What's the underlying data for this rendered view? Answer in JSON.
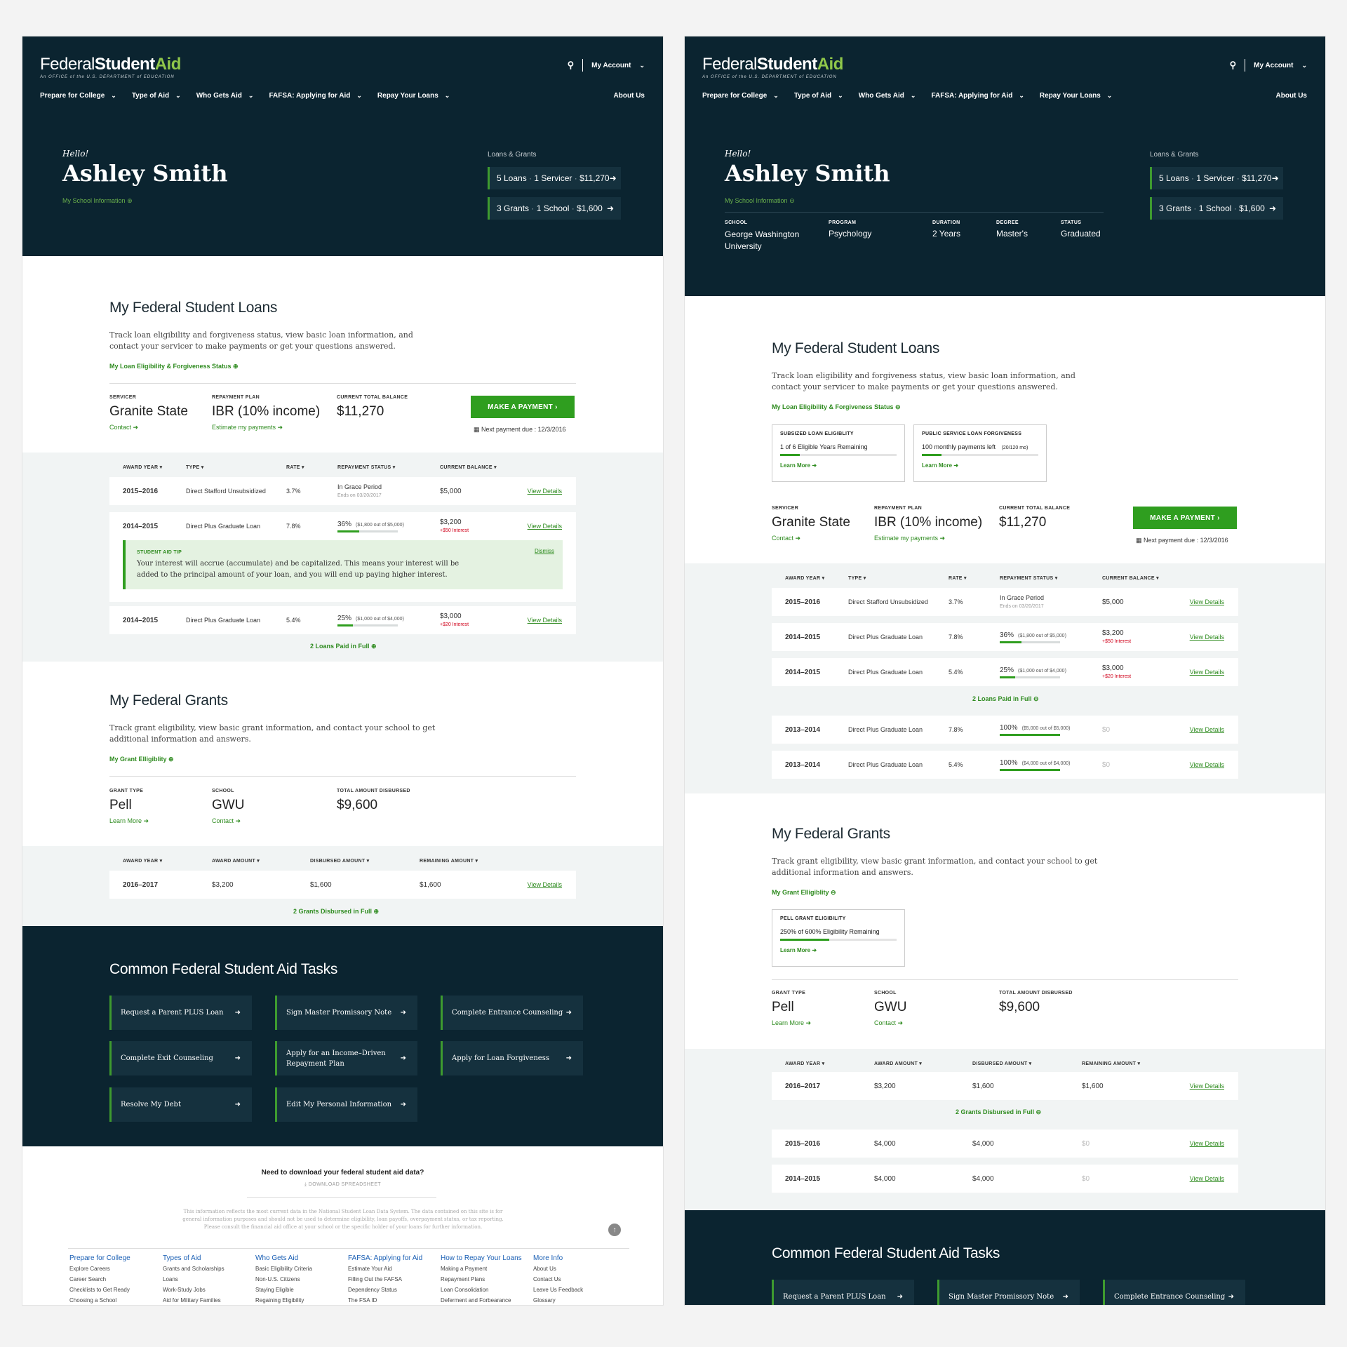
{
  "brand": {
    "federal": "Federal",
    "student": "Student",
    "aid": "Aid",
    "sub": "An OFFICE of the U.S. DEPARTMENT of EDUCATION"
  },
  "account": {
    "label": "My Account"
  },
  "nav": {
    "items": [
      "Prepare for College",
      "Type of Aid",
      "Who Gets Aid",
      "FAFSA: Applying for Aid",
      "Repay Your Loans"
    ],
    "about": "About Us"
  },
  "profile": {
    "hello": "Hello!",
    "name": "Ashley Smith",
    "school_info": "My School Information"
  },
  "summary": {
    "title": "Loans & Grants",
    "loans": {
      "count": "5 Loans",
      "servicer": "1 Servicer",
      "amount": "$11,270"
    },
    "grants": {
      "count": "3 Grants",
      "school": "1 School",
      "amount": "$1,600"
    }
  },
  "school": {
    "cols": [
      {
        "k": "SCHOOL",
        "v": "George Washington University"
      },
      {
        "k": "PROGRAM",
        "v": "Psychology"
      },
      {
        "k": "DURATION",
        "v": "2 Years"
      },
      {
        "k": "DEGREE",
        "v": "Master's"
      },
      {
        "k": "STATUS",
        "v": "Graduated"
      }
    ]
  },
  "loans": {
    "title": "My Federal Student Loans",
    "desc": "Track loan eligibility and forgiveness status, view basic loan information, and contact your servicer to make payments or get your questions answered.",
    "elig_link": "My Loan Eligibility & Forgiveness Status",
    "elig_boxes": [
      {
        "title": "SUBSIZED LOAN ELIGIBLITY",
        "value": "1 of 6 Eligible Years Remaining",
        "extra": "",
        "fill": 0.17,
        "link": "Learn More"
      },
      {
        "title": "PUBLIC SERVICE LOAN FORGIVENESS",
        "value": "100 monthly payments left",
        "extra": "(20/120 mo)",
        "fill": 0.17,
        "link": "Learn More"
      }
    ],
    "servicer_label": "SERVICER",
    "servicer": "Granite State",
    "contact": "Contact",
    "plan_label": "REPAYMENT PLAN",
    "plan": "IBR (10% income)",
    "estimate": "Estimate my payments",
    "balance_label": "CURRENT TOTAL BALANCE",
    "balance": "$11,270",
    "pay_button": "MAKE A PAYMENT",
    "next_payment": "Next payment due : 12/3/2016",
    "headers": [
      "AWARD YEAR",
      "TYPE",
      "RATE",
      "REPAYMENT STATUS",
      "CURRENT BALANCE"
    ],
    "rows": [
      {
        "year": "2015–2016",
        "type": "Direct Stafford Unsubsidized",
        "rate": "3.7%",
        "status": "In Grace Period",
        "status_sub": "Ends on 03/20/2017",
        "balance": "$5,000",
        "interest": "",
        "link": "View Details"
      },
      {
        "year": "2014–2015",
        "type": "Direct Plus Graduate Loan",
        "rate": "7.8%",
        "pct": "36%",
        "pct_detail": "($1,800 out of $5,000)",
        "fill": 0.36,
        "balance": "$3,200",
        "interest": "+$50 Interest",
        "link": "View Details"
      },
      {
        "year": "2014–2015",
        "type": "Direct Plus Graduate Loan",
        "rate": "5.4%",
        "pct": "25%",
        "pct_detail": "($1,000 out of $4,000)",
        "fill": 0.25,
        "balance": "$3,000",
        "interest": "+$20 Interest",
        "link": "View Details"
      }
    ],
    "paid_rows": [
      {
        "year": "2013–2014",
        "type": "Direct Plus Graduate Loan",
        "rate": "7.8%",
        "pct": "100%",
        "pct_detail": "($5,000 out of $5,000)",
        "fill": 1,
        "balance": "$0",
        "link": "View Details"
      },
      {
        "year": "2013–2014",
        "type": "Direct Plus Graduate Loan",
        "rate": "5.4%",
        "pct": "100%",
        "pct_detail": "($4,000 out of $4,000)",
        "fill": 1,
        "balance": "$0",
        "link": "View Details"
      }
    ],
    "tip": {
      "label": "STUDENT AID TIP",
      "dismiss": "Dismiss",
      "text": "Your interest will accrue (accumulate) and be capitalized. This means your interest will be added to the principal amount of your loan, and you will end up paying higher interest."
    },
    "paid_link": "2 Loans Paid in Full"
  },
  "grants": {
    "title": "My Federal Grants",
    "desc": "Track grant eligibility, view basic grant information, and contact your school to get additional information and answers.",
    "elig_link": "My Grant Elligiblity",
    "elig_box": {
      "title": "PELL GRANT ELIGIBILITY",
      "value": "250% of 600% Eligibility Remaining",
      "fill": 0.42,
      "link": "Learn More"
    },
    "type_label": "GRANT TYPE",
    "type": "Pell",
    "learn": "Learn More",
    "school_label": "SCHOOL",
    "school": "GWU",
    "contact": "Contact",
    "total_label": "TOTAL AMOUNT DISBURSED",
    "total": "$9,600",
    "headers": [
      "AWARD YEAR",
      "AWARD AMOUNT",
      "DISBURSED AMOUNT",
      "REMAINING AMOUNT"
    ],
    "rows": [
      {
        "year": "2016–2017",
        "award": "$3,200",
        "disbursed": "$1,600",
        "remaining": "$1,600",
        "link": "View Details"
      }
    ],
    "paid_rows": [
      {
        "year": "2015–2016",
        "award": "$4,000",
        "disbursed": "$4,000",
        "remaining": "$0",
        "link": "View Details"
      },
      {
        "year": "2014–2015",
        "award": "$4,000",
        "disbursed": "$4,000",
        "remaining": "$0",
        "link": "View Details"
      }
    ],
    "paid_link": "2 Grants Disbursed in Full"
  },
  "tasks": {
    "title": "Common Federal Student Aid Tasks",
    "items": [
      "Request a Parent PLUS Loan",
      "Sign Master Promissory Note",
      "Complete Entrance Counseling",
      "Complete Exit Counseling",
      "Apply for an Income–Driven Repayment Plan",
      "Apply for Loan Forgiveness",
      "Resolve My Debt",
      "Edit My Personal Information"
    ]
  },
  "footer": {
    "download_q": "Need to download your federal student aid data?",
    "download": "DOWNLOAD SPREADSHEET",
    "disclaimer": "This information reflects the most current data in the National Student Loan Data System. The data contained on this site is for general information purposes and should not be used to determine eligibility, loan payoffs, overpayment status, or tax reporting. Please consult the financial aid office at your school or the specific holder of your loans for further information.",
    "cols": [
      {
        "h": "Prepare for College",
        "items": [
          "Explore Careers",
          "Career Search",
          "Checklists to Get Ready",
          "Choosing a School"
        ]
      },
      {
        "h": "Types of Aid",
        "items": [
          "Grants and Scholarships",
          "Loans",
          "Work-Study Jobs",
          "Aid for Military Families"
        ]
      },
      {
        "h": "Who Gets Aid",
        "items": [
          "Basic Eligibility Criteria",
          "Non-U.S. Citizens",
          "Staying Eligible",
          "Regaining Eligibility"
        ]
      },
      {
        "h": "FAFSA: Applying for Aid",
        "items": [
          "Estimate Your Aid",
          "Filling Out the FAFSA",
          "Dependency Status",
          "The FSA ID"
        ]
      },
      {
        "h": "How to Repay Your Loans",
        "items": [
          "Making a Payment",
          "Repayment Plans",
          "Loan Consolidation",
          "Deferment and Forbearance"
        ]
      },
      {
        "h": "More Info",
        "items": [
          "About Us",
          "Contact Us",
          "Leave Us Feedback",
          "Glossary"
        ]
      }
    ]
  },
  "colors": {
    "navy": "#0b2430",
    "green": "#2f9e1f",
    "link_green": "#2e8b1f",
    "tip_bg": "#e4f2e1"
  }
}
